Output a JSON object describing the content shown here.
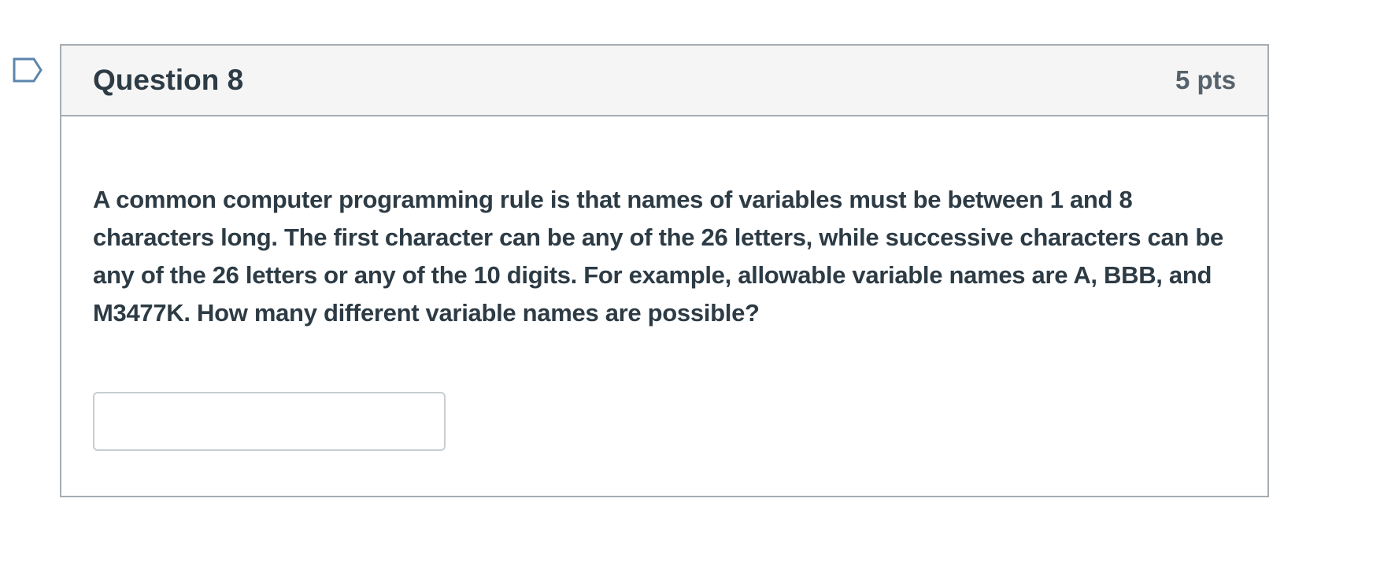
{
  "question": {
    "title": "Question 8",
    "points": "5 pts",
    "text": "A common computer programming rule is that names of variables must be between 1 and 8 characters long. The first character can be any of the 26 letters, while successive characters can be any of the 26 letters or any of the 10 digits. For example, allowable variable names are A, BBB, and M3477K. How many different variable names are possible?",
    "answer": {
      "value": "",
      "placeholder": ""
    },
    "flag_icon": "bookmark-flag-icon"
  },
  "colors": {
    "header_bg": "#f5f5f5",
    "border": "#a6adb3",
    "text": "#2d3b45",
    "points_text": "#56636c",
    "flag_outline": "#5b85ad"
  }
}
